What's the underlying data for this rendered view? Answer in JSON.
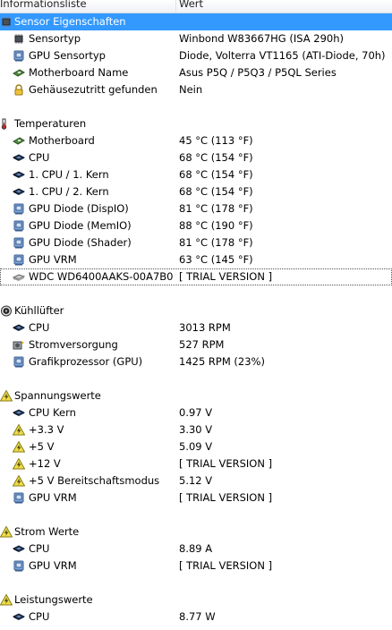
{
  "header": {
    "col1": "Informationsliste",
    "col2": "Wert"
  },
  "rows": [
    {
      "kind": "section",
      "icon": "chip-icon",
      "label": "Sensor Eigenschaften",
      "value": "",
      "selected": true
    },
    {
      "kind": "item",
      "icon": "chip-icon",
      "label": "Sensortyp",
      "value": "Winbond W83667HG  (ISA 290h)"
    },
    {
      "kind": "item",
      "icon": "gpu-icon",
      "label": "GPU Sensortyp",
      "value": "Diode, Volterra VT1165  (ATI-Diode, 70h)"
    },
    {
      "kind": "item",
      "icon": "motherboard-icon",
      "label": "Motherboard Name",
      "value": "Asus P5Q / P5Q3 / P5QL Series"
    },
    {
      "kind": "item",
      "icon": "lock-icon",
      "label": "Gehäusezutritt gefunden",
      "value": "Nein"
    },
    {
      "kind": "spacer"
    },
    {
      "kind": "section",
      "icon": "thermometer-icon",
      "label": "Temperaturen",
      "value": ""
    },
    {
      "kind": "item",
      "icon": "motherboard-icon",
      "label": "Motherboard",
      "value": "45 °C  (113 °F)"
    },
    {
      "kind": "item",
      "icon": "cpu-icon",
      "label": "CPU",
      "value": "68 °C  (154 °F)"
    },
    {
      "kind": "item",
      "icon": "cpu-icon",
      "label": "1. CPU / 1. Kern",
      "value": "68 °C  (154 °F)"
    },
    {
      "kind": "item",
      "icon": "cpu-icon",
      "label": "1. CPU / 2. Kern",
      "value": "68 °C  (154 °F)"
    },
    {
      "kind": "item",
      "icon": "gpu-icon",
      "label": "GPU Diode (DispIO)",
      "value": "81 °C  (178 °F)"
    },
    {
      "kind": "item",
      "icon": "gpu-icon",
      "label": "GPU Diode (MemIO)",
      "value": "88 °C  (190 °F)"
    },
    {
      "kind": "item",
      "icon": "gpu-icon",
      "label": "GPU Diode (Shader)",
      "value": "81 °C  (178 °F)"
    },
    {
      "kind": "item",
      "icon": "gpu-icon",
      "label": "GPU VRM",
      "value": "63 °C  (145 °F)"
    },
    {
      "kind": "item",
      "icon": "harddisk-icon",
      "label": "WDC WD6400AAKS-00A7B0",
      "value": "[ TRIAL VERSION ]",
      "focus": true
    },
    {
      "kind": "spacer"
    },
    {
      "kind": "section",
      "icon": "fan-icon",
      "label": "Kühllüfter",
      "value": ""
    },
    {
      "kind": "item",
      "icon": "cpu-icon",
      "label": "CPU",
      "value": "3013 RPM"
    },
    {
      "kind": "item",
      "icon": "power-supply-fan-icon",
      "label": "Stromversorgung",
      "value": "527 RPM"
    },
    {
      "kind": "item",
      "icon": "gpu-icon",
      "label": "Grafikprozessor (GPU)",
      "value": "1425 RPM  (23%)"
    },
    {
      "kind": "spacer"
    },
    {
      "kind": "section",
      "icon": "voltage-icon",
      "label": "Spannungswerte",
      "value": ""
    },
    {
      "kind": "item",
      "icon": "cpu-icon",
      "label": "CPU Kern",
      "value": "0.97 V"
    },
    {
      "kind": "item",
      "icon": "voltage-icon",
      "label": "+3.3 V",
      "value": "3.30 V"
    },
    {
      "kind": "item",
      "icon": "voltage-icon",
      "label": "+5 V",
      "value": "5.09 V"
    },
    {
      "kind": "item",
      "icon": "voltage-icon",
      "label": "+12 V",
      "value": "[ TRIAL VERSION ]"
    },
    {
      "kind": "item",
      "icon": "voltage-icon",
      "label": "+5 V Bereitschaftsmodus",
      "value": "5.12 V"
    },
    {
      "kind": "item",
      "icon": "gpu-icon",
      "label": "GPU VRM",
      "value": "[ TRIAL VERSION ]"
    },
    {
      "kind": "spacer"
    },
    {
      "kind": "section",
      "icon": "voltage-icon",
      "label": "Strom Werte",
      "value": ""
    },
    {
      "kind": "item",
      "icon": "cpu-icon",
      "label": "CPU",
      "value": "8.89 A"
    },
    {
      "kind": "item",
      "icon": "gpu-icon",
      "label": "GPU VRM",
      "value": "[ TRIAL VERSION ]"
    },
    {
      "kind": "spacer"
    },
    {
      "kind": "section",
      "icon": "voltage-icon",
      "label": "Leistungswerte",
      "value": ""
    },
    {
      "kind": "item",
      "icon": "cpu-icon",
      "label": "CPU",
      "value": "8.77 W"
    }
  ]
}
